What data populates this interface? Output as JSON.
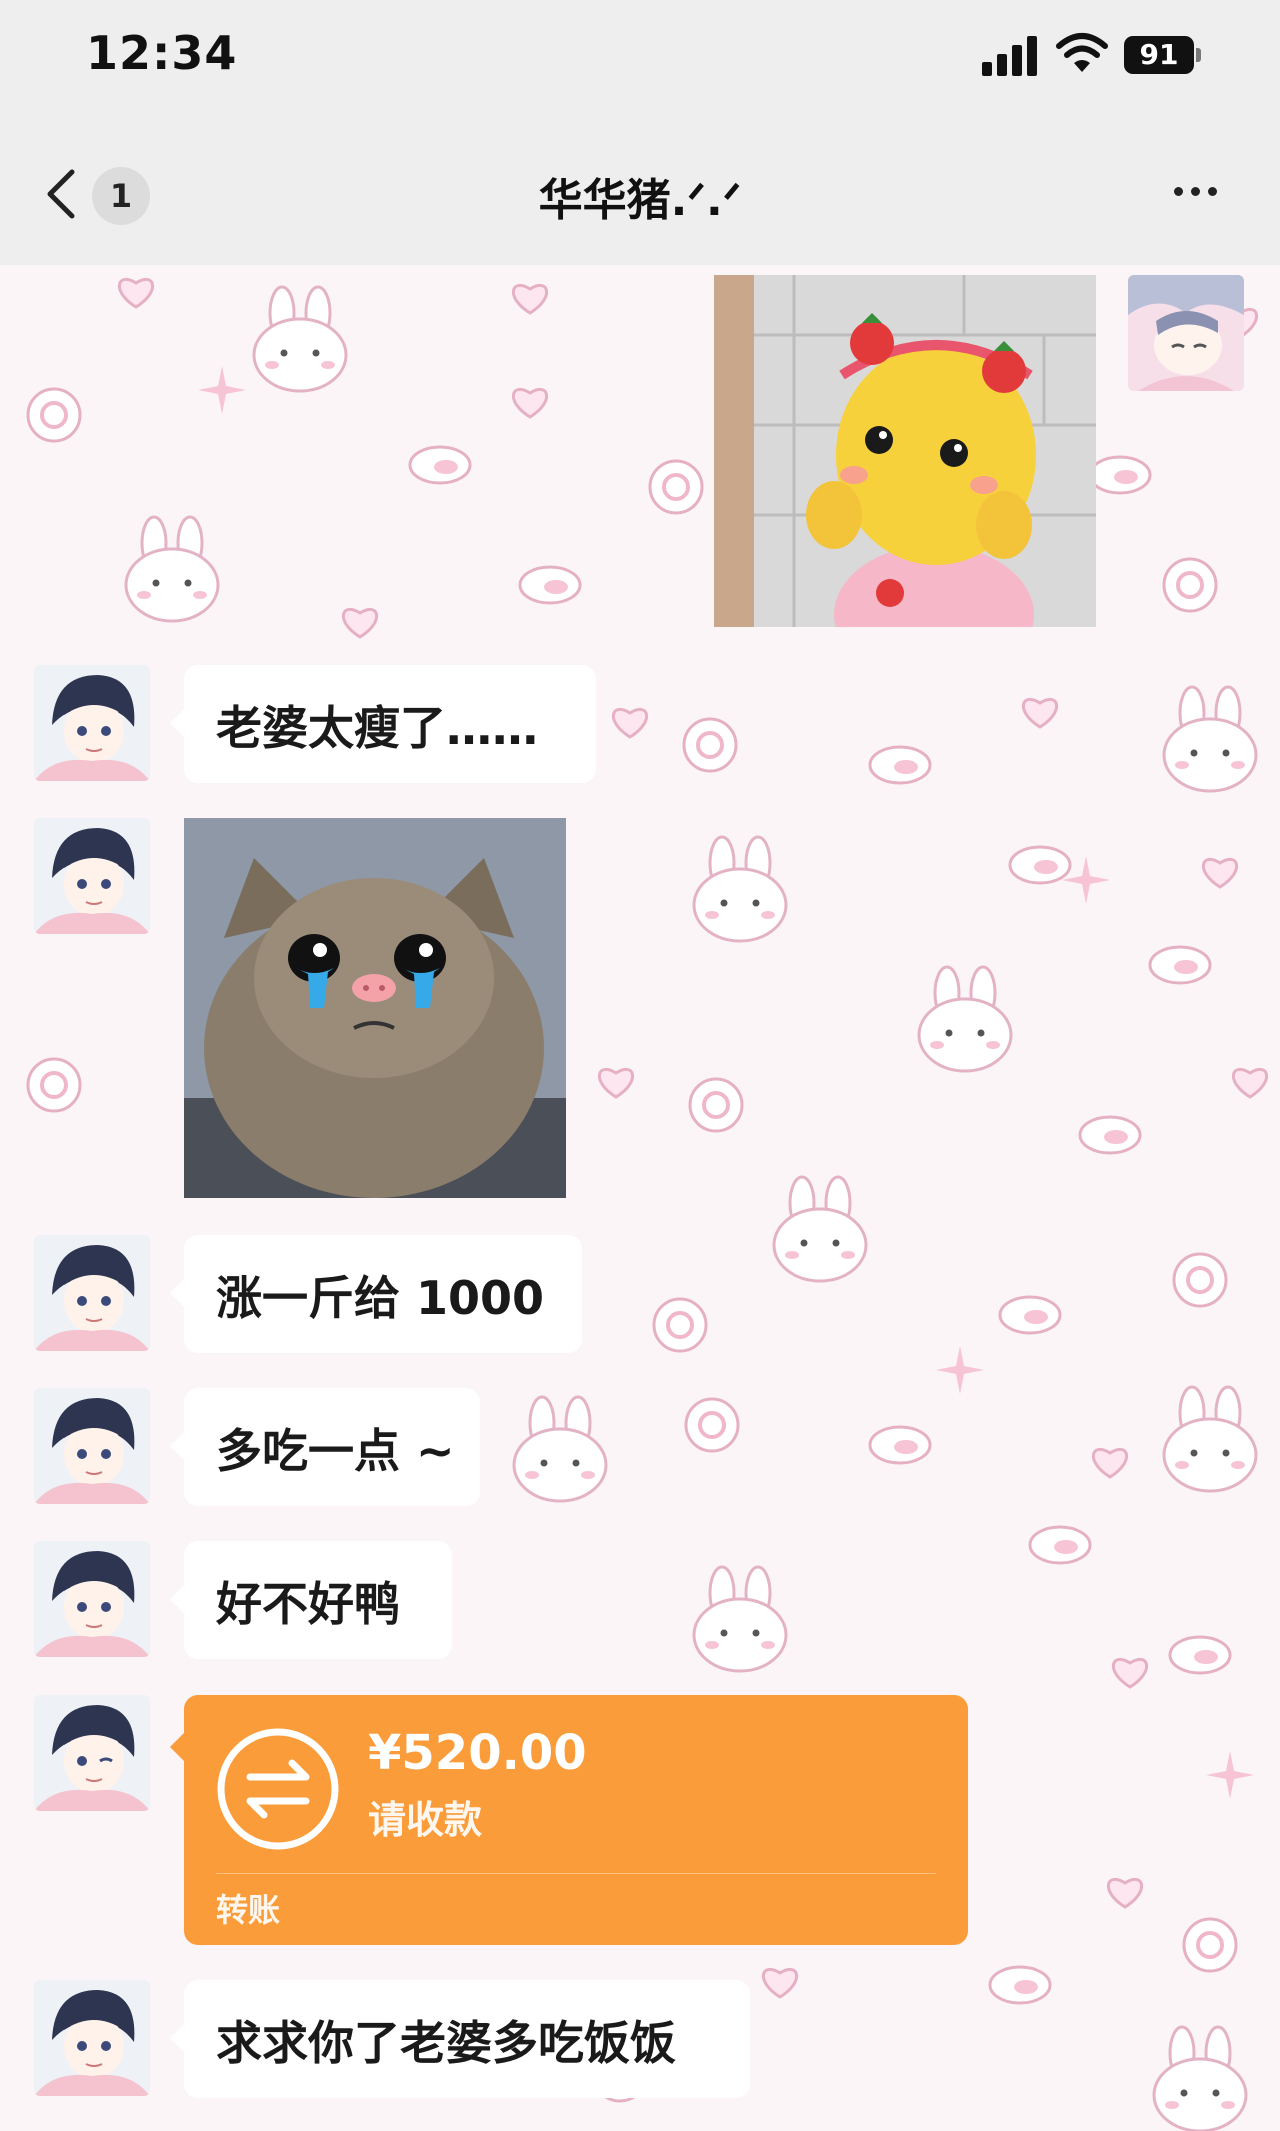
{
  "status_bar": {
    "time": "12:34",
    "battery_level": "91",
    "icons": [
      "signal-icon",
      "wifi-icon",
      "battery-icon"
    ]
  },
  "nav": {
    "back_icon": "chevron-left-icon",
    "unread_count": "1",
    "title": "华华猪.ᐟ.ᐟ",
    "more_icon": "more-horizontal-icon"
  },
  "messages": [
    {
      "side": "right",
      "type": "image",
      "desc_icon": "strawberry-chick-sticker"
    },
    {
      "side": "left",
      "type": "text",
      "text": "老婆太瘦了……"
    },
    {
      "side": "left",
      "type": "image",
      "desc_icon": "crying-kitten-sticker"
    },
    {
      "side": "left",
      "type": "text",
      "text": "涨一斤给 1000"
    },
    {
      "side": "left",
      "type": "text",
      "text": "多吃一点 ~"
    },
    {
      "side": "left",
      "type": "text",
      "text": "好不好鸭"
    },
    {
      "side": "left",
      "type": "transfer",
      "amount": "¥520.00",
      "status": "请收款",
      "label": "转账"
    },
    {
      "side": "left",
      "type": "text",
      "text": "求求你了老婆多吃饭饭"
    }
  ],
  "colors": {
    "transfer_card": "#f99c39",
    "chat_background": "#fbf5f8",
    "header": "#eeeeee"
  }
}
